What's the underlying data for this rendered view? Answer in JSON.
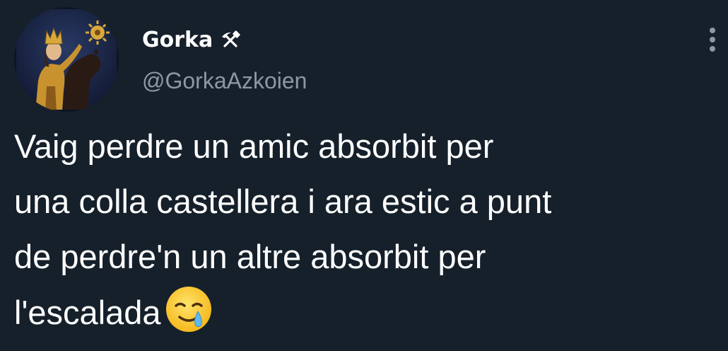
{
  "author": {
    "display_name": "Gorka",
    "badge_icon": "hammer-and-pick-icon",
    "handle": "@GorkaAzkoien",
    "avatar": "avatar-illustration"
  },
  "menu": {
    "icon": "more-vertical-icon"
  },
  "tweet": {
    "lines": [
      "Vaig perdre un amic absorbit per",
      "una colla castellera i ara estic a punt",
      "de perdre'n un altre absorbit per",
      "l'escalada"
    ],
    "emoji": "smiling-face-with-tear-icon"
  },
  "colors": {
    "background": "#15202b",
    "text": "#ffffff",
    "secondary_text": "#8b98a5"
  }
}
